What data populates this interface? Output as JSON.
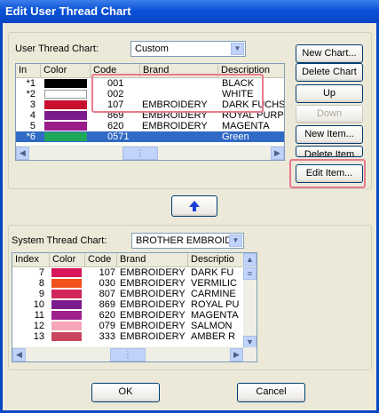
{
  "window": {
    "title": "Edit User Thread Chart"
  },
  "user": {
    "label": "User Thread Chart:",
    "combo_value": "Custom",
    "headers": [
      "In",
      "Color",
      "Code",
      "Brand",
      "Description"
    ],
    "rows": [
      {
        "index": "*1",
        "color": "#000000",
        "code": "001",
        "brand": "",
        "description": "BLACK"
      },
      {
        "index": "*2",
        "color": "#ffffff",
        "code": "002",
        "brand": "",
        "description": "WHITE"
      },
      {
        "index": "3",
        "color": "#c8102e",
        "code": "107",
        "brand": "EMBROIDERY",
        "description": "DARK FUCHSIA"
      },
      {
        "index": "4",
        "color": "#7b1a8c",
        "code": "869",
        "brand": "EMBROIDERY",
        "description": "ROYAL PURPLE"
      },
      {
        "index": "5",
        "color": "#9b1d8a",
        "code": "620",
        "brand": "EMBROIDERY",
        "description": "MAGENTA"
      },
      {
        "index": "*6",
        "color": "#1fa85a",
        "code": "0571",
        "brand": "",
        "description": "Green"
      }
    ],
    "buttons": {
      "new_chart": "New Chart...",
      "delete_chart": "Delete Chart",
      "up": "Up",
      "down": "Down",
      "new_item": "New Item...",
      "delete_item": "Delete Item",
      "edit_item": "Edit Item..."
    }
  },
  "system": {
    "label": "System Thread Chart:",
    "combo_value": "BROTHER EMBROID",
    "headers": [
      "Index",
      "Color",
      "Code",
      "Brand",
      "Descriptio"
    ],
    "rows": [
      {
        "index": "7",
        "color": "#d6155a",
        "code": "107",
        "brand": "EMBROIDERY",
        "description": "DARK FU"
      },
      {
        "index": "8",
        "color": "#f2501c",
        "code": "030",
        "brand": "EMBROIDERY",
        "description": "VERMILIC"
      },
      {
        "index": "9",
        "color": "#d1265b",
        "code": "807",
        "brand": "EMBROIDERY",
        "description": "CARMINE"
      },
      {
        "index": "10",
        "color": "#7b1a8c",
        "code": "869",
        "brand": "EMBROIDERY",
        "description": "ROYAL PU"
      },
      {
        "index": "11",
        "color": "#a0208e",
        "code": "620",
        "brand": "EMBROIDERY",
        "description": "MAGENTA"
      },
      {
        "index": "12",
        "color": "#f5a6b8",
        "code": "079",
        "brand": "EMBROIDERY",
        "description": "SALMON"
      },
      {
        "index": "13",
        "color": "#c9455f",
        "code": "333",
        "brand": "EMBROIDERY",
        "description": "AMBER R"
      }
    ]
  },
  "footer": {
    "ok": "OK",
    "cancel": "Cancel"
  }
}
